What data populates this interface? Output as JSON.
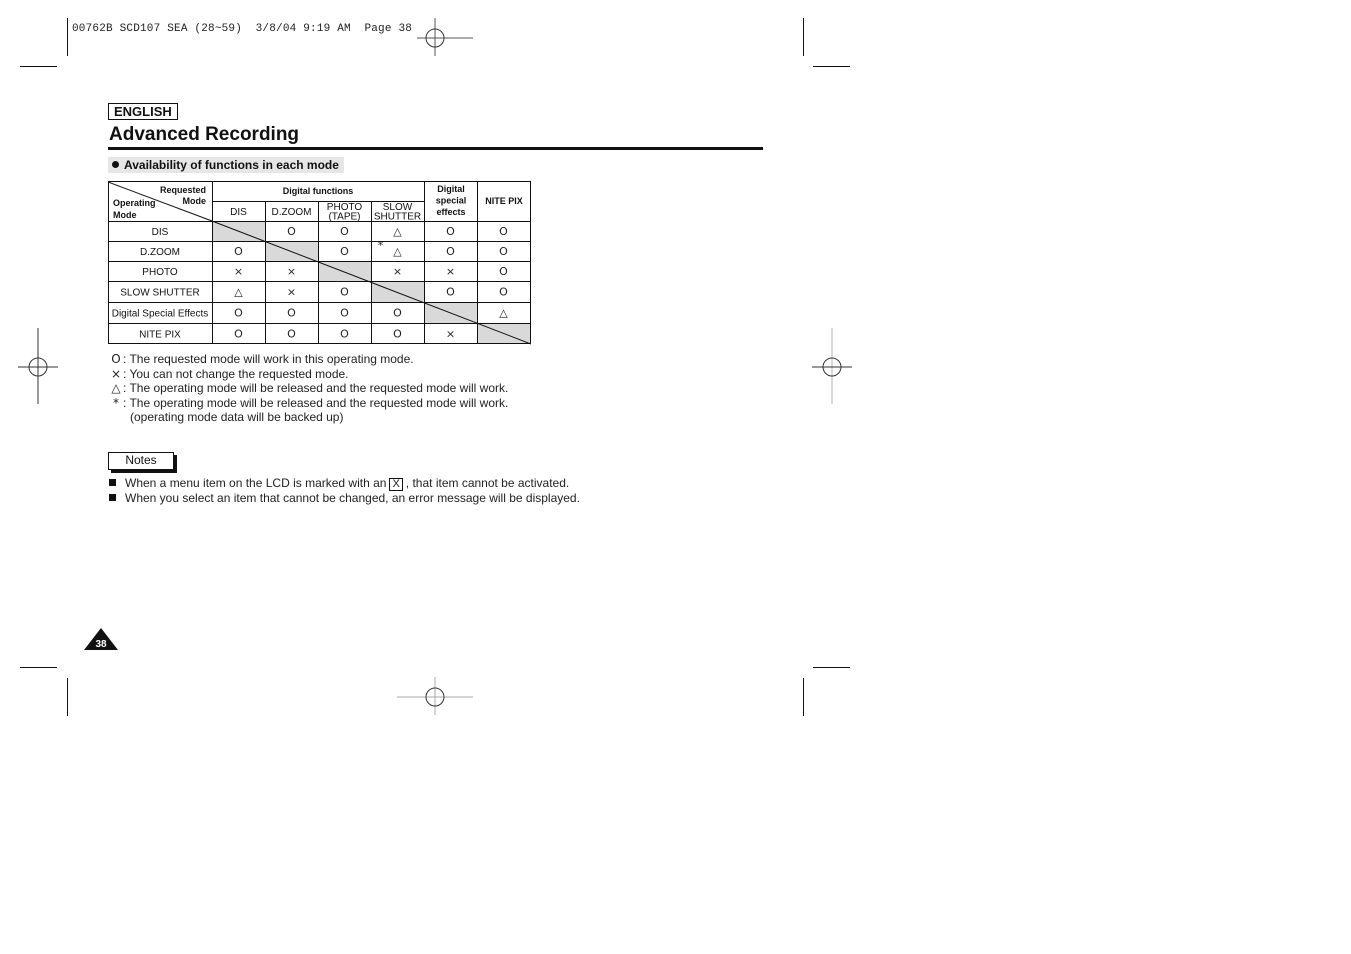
{
  "slug": "00762B SCD107 SEA (28~59)  3/8/04 9:19 AM  Page 38",
  "header": {
    "language": "ENGLISH",
    "title": "Advanced Recording",
    "section": "Availability of functions in each mode"
  },
  "table": {
    "corner": {
      "top": "Requested",
      "top2": "Mode",
      "bottom": "Operating",
      "bottom2": "Mode"
    },
    "group_headers": {
      "digital_functions": "Digital functions",
      "digital_special": [
        "Digital",
        "special",
        "effects"
      ],
      "nite_pix": "NITE PIX"
    },
    "columns": [
      {
        "lines": [
          "DIS"
        ]
      },
      {
        "lines": [
          "D.ZOOM"
        ]
      },
      {
        "lines": [
          "PHOTO",
          "(TAPE)"
        ]
      },
      {
        "lines": [
          "SLOW",
          "SHUTTER"
        ]
      }
    ],
    "rows": [
      {
        "label": "DIS",
        "cells": [
          "",
          "O",
          "O",
          "△",
          "O",
          "O"
        ]
      },
      {
        "label": "D.ZOOM",
        "cells": [
          "O",
          "",
          "O",
          "*△",
          "O",
          "O"
        ]
      },
      {
        "label": "PHOTO",
        "cells": [
          "×",
          "×",
          "",
          "×",
          "×",
          "O"
        ]
      },
      {
        "label": "SLOW SHUTTER",
        "cells": [
          "△",
          "×",
          "O",
          "",
          "O",
          "O"
        ]
      },
      {
        "label": "Digital Special Effects",
        "cells": [
          "O",
          "O",
          "O",
          "O",
          "",
          "△"
        ]
      },
      {
        "label": "NITE PIX",
        "cells": [
          "O",
          "O",
          "O",
          "O",
          "×",
          ""
        ]
      }
    ]
  },
  "legend": [
    {
      "symbol": "O",
      "text": ": The requested mode will work in this operating mode."
    },
    {
      "symbol": "×",
      "text": ": You can not change the requested mode."
    },
    {
      "symbol": "△",
      "text": ": The operating mode will be released and the requested mode will work."
    },
    {
      "symbol": "*",
      "text": ": The operating mode will be released and the requested mode will work."
    },
    {
      "symbol": "",
      "text": "(operating mode data will be backed up)"
    }
  ],
  "notes": {
    "label": "Notes",
    "items": [
      {
        "before": "When a menu item on the LCD is marked with an",
        "mark": "X",
        "after": ", that item cannot be activated."
      },
      {
        "before": "When you select an item that cannot be changed, an error message will be displayed.",
        "mark": "",
        "after": ""
      }
    ]
  },
  "page_number": "38",
  "colors": {
    "shaded_cell": "#d9d9d9",
    "section_bg": "#e6e6e6",
    "ink": "#111111"
  }
}
